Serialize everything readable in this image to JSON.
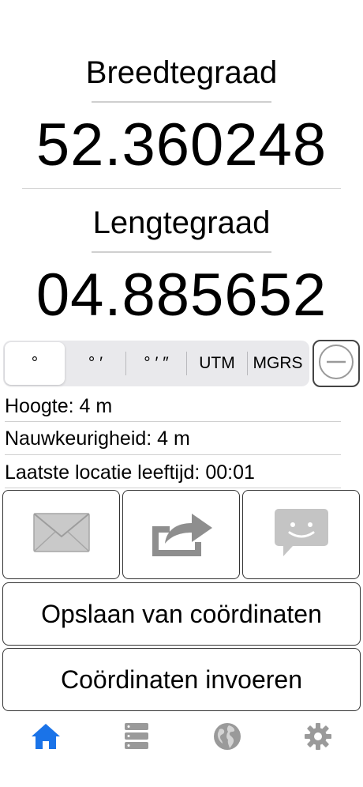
{
  "latitude": {
    "label": "Breedtegraad",
    "value": "52.360248"
  },
  "longitude": {
    "label": "Lengtegraad",
    "value": "04.885652"
  },
  "format_selector": {
    "options": [
      "°",
      "° ′",
      "° ′ ″",
      "UTM",
      "MGRS"
    ],
    "selected": "°"
  },
  "info": {
    "altitude": "Hoogte: 4 m",
    "accuracy": "Nauwkeurigheid: 4 m",
    "location_age": "Laatste locatie leeftijd: 00:01"
  },
  "share_buttons": [
    {
      "icon": "mail-icon"
    },
    {
      "icon": "share-icon"
    },
    {
      "icon": "message-icon"
    }
  ],
  "actions": {
    "save": "Opslaan van coördinaten",
    "enter": "Coördinaten invoeren"
  },
  "tabbar": {
    "tabs": [
      {
        "icon": "home-icon",
        "active": true
      },
      {
        "icon": "server-list-icon",
        "active": false
      },
      {
        "icon": "globe-icon",
        "active": false
      },
      {
        "icon": "gear-icon",
        "active": false
      }
    ]
  },
  "colors": {
    "active_tab": "#1a73e8",
    "inactive_tab": "#9a9a9a",
    "share_icon_gray": "#8e8e8e"
  }
}
